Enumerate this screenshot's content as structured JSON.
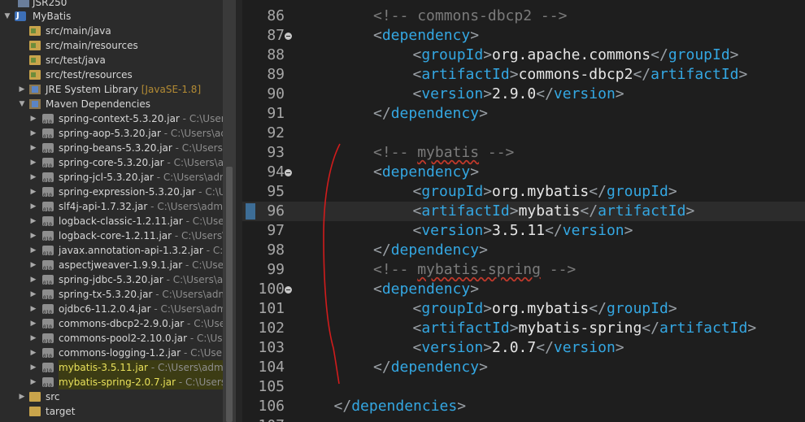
{
  "explorer": {
    "top_partial": "JSR250",
    "project": "MyBatis",
    "src_folders": [
      "src/main/java",
      "src/main/resources",
      "src/test/java",
      "src/test/resources"
    ],
    "jre": {
      "label": "JRE System Library",
      "decoration": "[JavaSE-1.8]"
    },
    "maven": "Maven Dependencies",
    "jars": [
      {
        "name": "spring-context-5.3.20.jar",
        "path": " - C:\\Users"
      },
      {
        "name": "spring-aop-5.3.20.jar",
        "path": " - C:\\Users\\adr"
      },
      {
        "name": "spring-beans-5.3.20.jar",
        "path": " - C:\\Users\\a"
      },
      {
        "name": "spring-core-5.3.20.jar",
        "path": " - C:\\Users\\ad"
      },
      {
        "name": "spring-jcl-5.3.20.jar",
        "path": " - C:\\Users\\adm"
      },
      {
        "name": "spring-expression-5.3.20.jar",
        "path": " - C:\\Use"
      },
      {
        "name": "slf4j-api-1.7.32.jar",
        "path": " - C:\\Users\\admin"
      },
      {
        "name": "logback-classic-1.2.11.jar",
        "path": " - C:\\Users\\"
      },
      {
        "name": "logback-core-1.2.11.jar",
        "path": " - C:\\Users\\a"
      },
      {
        "name": "javax.annotation-api-1.3.2.jar",
        "path": " - C:\\Us"
      },
      {
        "name": "aspectjweaver-1.9.9.1.jar",
        "path": " - C:\\Users"
      },
      {
        "name": "spring-jdbc-5.3.20.jar",
        "path": " - C:\\Users\\ad"
      },
      {
        "name": "spring-tx-5.3.20.jar",
        "path": " - C:\\Users\\admi"
      },
      {
        "name": "ojdbc6-11.2.0.4.jar",
        "path": " - C:\\Users\\admi"
      },
      {
        "name": "commons-dbcp2-2.9.0.jar",
        "path": " - C:\\Users"
      },
      {
        "name": "commons-pool2-2.10.0.jar",
        "path": " - C:\\Users"
      },
      {
        "name": "commons-logging-1.2.jar",
        "path": " - C:\\Users"
      },
      {
        "name": "mybatis-3.5.11.jar",
        "path": " - C:\\Users\\admin"
      },
      {
        "name": "mybatis-spring-2.0.7.jar",
        "path": " - C:\\Users\\a"
      }
    ],
    "src": "src",
    "target": "target"
  },
  "editor": {
    "lines": [
      {
        "n": "86",
        "fold": false,
        "indent": 2,
        "kind": "comment",
        "text": "commons-dbcp2"
      },
      {
        "n": "87",
        "fold": true,
        "indent": 2,
        "kind": "open",
        "tag": "dependency"
      },
      {
        "n": "88",
        "fold": false,
        "indent": 3,
        "kind": "element",
        "tag": "groupId",
        "value": "org.apache.commons"
      },
      {
        "n": "89",
        "fold": false,
        "indent": 3,
        "kind": "element",
        "tag": "artifactId",
        "value": "commons-dbcp2"
      },
      {
        "n": "90",
        "fold": false,
        "indent": 3,
        "kind": "element",
        "tag": "version",
        "value": "2.9.0"
      },
      {
        "n": "91",
        "fold": false,
        "indent": 2,
        "kind": "close",
        "tag": "dependency"
      },
      {
        "n": "92",
        "fold": false,
        "indent": 0,
        "kind": "blank"
      },
      {
        "n": "93",
        "fold": false,
        "indent": 2,
        "kind": "comment",
        "text": "mybatis",
        "spell": true
      },
      {
        "n": "94",
        "fold": true,
        "indent": 2,
        "kind": "open",
        "tag": "dependency"
      },
      {
        "n": "95",
        "fold": false,
        "indent": 3,
        "kind": "element",
        "tag": "groupId",
        "value": "org.mybatis"
      },
      {
        "n": "96",
        "fold": false,
        "indent": 3,
        "kind": "element",
        "tag": "artifactId",
        "value": "mybatis",
        "current": true
      },
      {
        "n": "97",
        "fold": false,
        "indent": 3,
        "kind": "element",
        "tag": "version",
        "value": "3.5.11"
      },
      {
        "n": "98",
        "fold": false,
        "indent": 2,
        "kind": "close",
        "tag": "dependency"
      },
      {
        "n": "99",
        "fold": false,
        "indent": 2,
        "kind": "comment",
        "text": "mybatis-spring",
        "spell": true
      },
      {
        "n": "100",
        "fold": true,
        "indent": 2,
        "kind": "open",
        "tag": "dependency"
      },
      {
        "n": "101",
        "fold": false,
        "indent": 3,
        "kind": "element",
        "tag": "groupId",
        "value": "org.mybatis"
      },
      {
        "n": "102",
        "fold": false,
        "indent": 3,
        "kind": "element",
        "tag": "artifactId",
        "value": "mybatis-spring"
      },
      {
        "n": "103",
        "fold": false,
        "indent": 3,
        "kind": "element",
        "tag": "version",
        "value": "2.0.7"
      },
      {
        "n": "104",
        "fold": false,
        "indent": 2,
        "kind": "close",
        "tag": "dependency"
      },
      {
        "n": "105",
        "fold": false,
        "indent": 0,
        "kind": "blank"
      },
      {
        "n": "106",
        "fold": false,
        "indent": 1,
        "kind": "close",
        "tag": "dependencies"
      },
      {
        "n": "107",
        "fold": false,
        "indent": 0,
        "kind": "blank"
      }
    ]
  },
  "colors": {
    "tag": "#34a7e2",
    "bracket": "#9aa0a6",
    "comment": "#7b7b7b",
    "annotation": "#d01c1c"
  }
}
